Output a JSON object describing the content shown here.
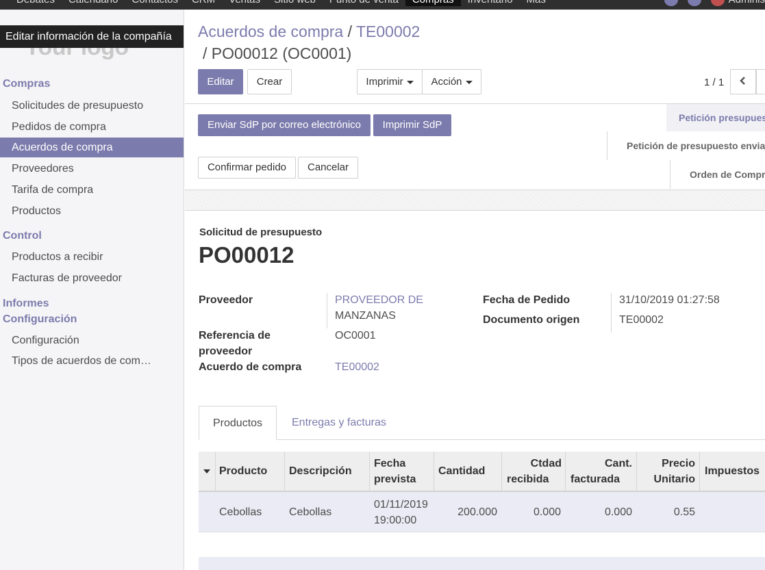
{
  "topbar": {
    "menu": [
      "Debates",
      "Calendario",
      "Contactos",
      "CRM",
      "Ventas",
      "Sitio web",
      "Punto de venta",
      "Compras",
      "Inventario",
      "Más"
    ],
    "active": "Compras",
    "user": "Adminis"
  },
  "sidebar": {
    "logo": "Your logo",
    "tooltip": "Editar información de la compañía",
    "sections": {
      "compras": "Compras",
      "control": "Control",
      "informes": "Informes",
      "configuracion": "Configuración"
    },
    "items": {
      "solicitudes": "Solicitudes de presupuesto",
      "pedidos": "Pedidos de compra",
      "acuerdos": "Acuerdos de compra",
      "proveedores": "Proveedores",
      "tarifa": "Tarifa de compra",
      "productos": "Productos",
      "recibir": "Productos a recibir",
      "facturas": "Facturas de proveedor",
      "config": "Configuración",
      "tipos": "Tipos de acuerdos de com…"
    }
  },
  "breadcrumb": {
    "parent": "Acuerdos de compra",
    "sep1": "/",
    "middle": "TE00002",
    "sep2": "/",
    "current": "PO00012 (OC0001)"
  },
  "toolbar": {
    "edit": "Editar",
    "create": "Crear",
    "print": "Imprimir",
    "action": "Acción",
    "pager": "1 / 1"
  },
  "status": {
    "send_rfq": "Enviar SdP por correo electrónico",
    "print_rfq": "Imprimir SdP",
    "confirm": "Confirmar pedido",
    "cancel": "Cancelar",
    "stages": [
      "Petición presupues",
      "Petición de presupuesto envia",
      "Orden de Compr"
    ]
  },
  "form": {
    "doc_type": "Solicitud de presupuesto",
    "name": "PO00012",
    "labels": {
      "vendor": "Proveedor",
      "vendor_ref_1": "Referencia de",
      "vendor_ref_2": "proveedor",
      "agreement": "Acuerdo de compra",
      "order_date": "Fecha de Pedido",
      "origin": "Documento origen"
    },
    "values": {
      "vendor_1": "PROVEEDOR DE",
      "vendor_2": "MANZANAS",
      "vendor_ref": "OC0001",
      "agreement": "TE00002",
      "order_date": "31/10/2019 01:27:58",
      "origin": "TE00002"
    }
  },
  "tabs": {
    "products": "Productos",
    "deliveries": "Entregas y facturas"
  },
  "table": {
    "headers": {
      "product": "Producto",
      "description": "Descripción",
      "date_1": "Fecha",
      "date_2": "prevista",
      "qty": "Cantidad",
      "received_1": "Ctdad",
      "received_2": "recibida",
      "invoiced_1": "Cant.",
      "invoiced_2": "facturada",
      "price_1": "Precio",
      "price_2": "Unitario",
      "taxes": "Impuestos"
    },
    "row": {
      "product": "Cebollas",
      "description": "Cebollas",
      "date_1": "01/11/2019",
      "date_2": "19:00:00",
      "qty": "200.000",
      "received": "0.000",
      "invoiced": "0.000",
      "price": "0.55"
    }
  }
}
